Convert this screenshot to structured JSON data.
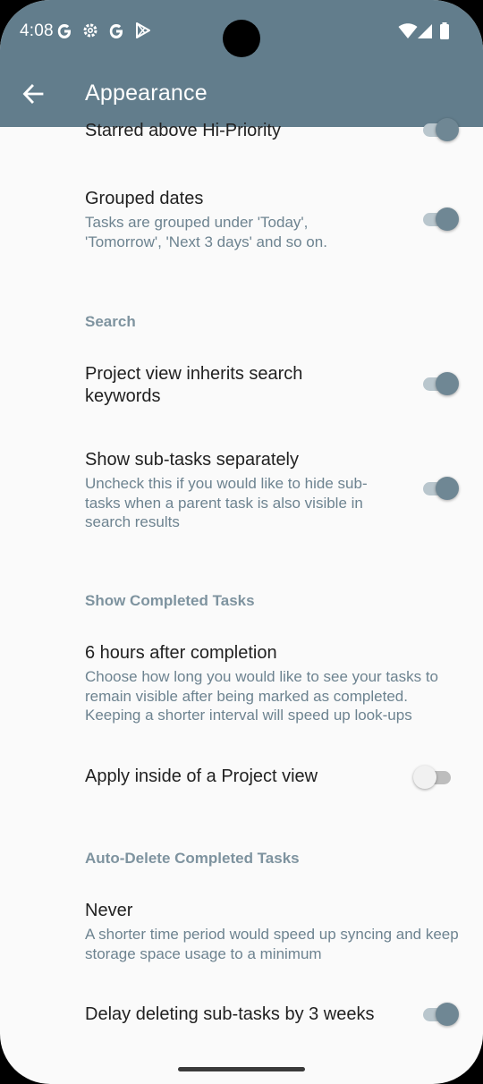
{
  "status_bar": {
    "time": "4:08"
  },
  "app_bar": {
    "title": "Appearance"
  },
  "prefs": [
    {
      "title": "Starred above Hi-Priority",
      "subtitle": "",
      "switch": "on"
    },
    {
      "title": "Grouped dates",
      "subtitle": "Tasks are grouped under 'Today', 'Tomorrow', 'Next 3 days' and so on.",
      "switch": "on"
    },
    {
      "title": "Project view inherits search keywords",
      "subtitle": "",
      "switch": "on"
    },
    {
      "title": "Show sub-tasks separately",
      "subtitle": "Uncheck this if you would like to hide sub-tasks when a parent task is also visible in search results",
      "switch": "on"
    },
    {
      "title": "6 hours after completion",
      "subtitle": "Choose how long you would like to see your tasks to remain visible after being marked as completed. Keeping a shorter interval will speed up look-ups"
    },
    {
      "title": "Apply inside of a Project view",
      "subtitle": "",
      "switch": "off"
    },
    {
      "title": "Never",
      "subtitle": "A shorter time period would speed up syncing and keep storage space usage to a minimum"
    },
    {
      "title": "Delay deleting sub-tasks by 3 weeks",
      "subtitle": "",
      "switch": "on"
    }
  ],
  "sections": {
    "search": "Search",
    "show_completed": "Show Completed Tasks",
    "auto_delete": "Auto-Delete Completed Tasks"
  },
  "colors": {
    "app_bar": "#627d8c",
    "accent": "#6f8794",
    "background": "#fafafa"
  }
}
